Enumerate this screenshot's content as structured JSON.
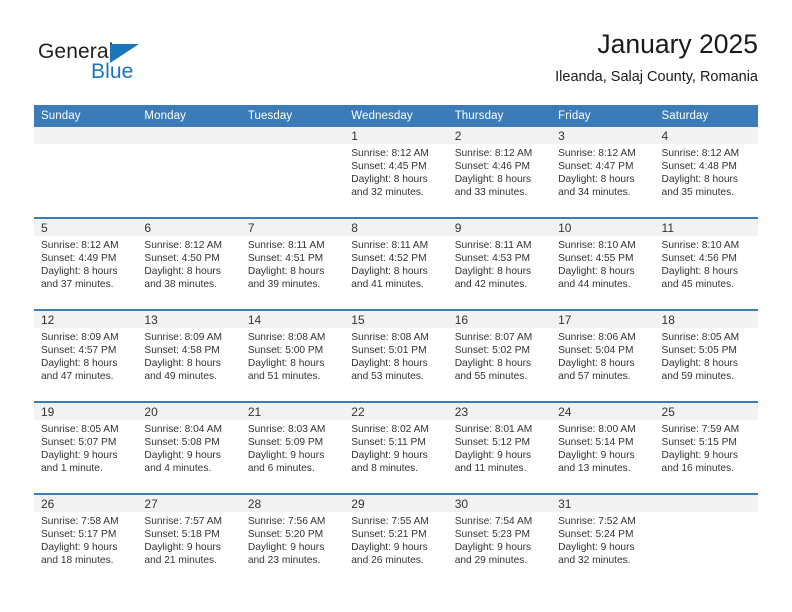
{
  "brand": {
    "word_one": "General",
    "word_two": "Blue",
    "triangle_color": "#1b75bb",
    "text_color": "#231f20"
  },
  "header": {
    "title": "January 2025",
    "subtitle": "Ileanda, Salaj County, Romania"
  },
  "theme": {
    "header_bg": "#3b7cb8",
    "header_text": "#ffffff",
    "daynum_band_bg": "#f2f2f2",
    "body_text": "#333333",
    "row_divider": "#3b7cb8"
  },
  "calendar": {
    "type": "table",
    "columns": [
      "Sunday",
      "Monday",
      "Tuesday",
      "Wednesday",
      "Thursday",
      "Friday",
      "Saturday"
    ],
    "weeks": [
      [
        {
          "day": "",
          "lines": []
        },
        {
          "day": "",
          "lines": []
        },
        {
          "day": "",
          "lines": []
        },
        {
          "day": "1",
          "lines": [
            "Sunrise: 8:12 AM",
            "Sunset: 4:45 PM",
            "Daylight: 8 hours",
            "and 32 minutes."
          ]
        },
        {
          "day": "2",
          "lines": [
            "Sunrise: 8:12 AM",
            "Sunset: 4:46 PM",
            "Daylight: 8 hours",
            "and 33 minutes."
          ]
        },
        {
          "day": "3",
          "lines": [
            "Sunrise: 8:12 AM",
            "Sunset: 4:47 PM",
            "Daylight: 8 hours",
            "and 34 minutes."
          ]
        },
        {
          "day": "4",
          "lines": [
            "Sunrise: 8:12 AM",
            "Sunset: 4:48 PM",
            "Daylight: 8 hours",
            "and 35 minutes."
          ]
        }
      ],
      [
        {
          "day": "5",
          "lines": [
            "Sunrise: 8:12 AM",
            "Sunset: 4:49 PM",
            "Daylight: 8 hours",
            "and 37 minutes."
          ]
        },
        {
          "day": "6",
          "lines": [
            "Sunrise: 8:12 AM",
            "Sunset: 4:50 PM",
            "Daylight: 8 hours",
            "and 38 minutes."
          ]
        },
        {
          "day": "7",
          "lines": [
            "Sunrise: 8:11 AM",
            "Sunset: 4:51 PM",
            "Daylight: 8 hours",
            "and 39 minutes."
          ]
        },
        {
          "day": "8",
          "lines": [
            "Sunrise: 8:11 AM",
            "Sunset: 4:52 PM",
            "Daylight: 8 hours",
            "and 41 minutes."
          ]
        },
        {
          "day": "9",
          "lines": [
            "Sunrise: 8:11 AM",
            "Sunset: 4:53 PM",
            "Daylight: 8 hours",
            "and 42 minutes."
          ]
        },
        {
          "day": "10",
          "lines": [
            "Sunrise: 8:10 AM",
            "Sunset: 4:55 PM",
            "Daylight: 8 hours",
            "and 44 minutes."
          ]
        },
        {
          "day": "11",
          "lines": [
            "Sunrise: 8:10 AM",
            "Sunset: 4:56 PM",
            "Daylight: 8 hours",
            "and 45 minutes."
          ]
        }
      ],
      [
        {
          "day": "12",
          "lines": [
            "Sunrise: 8:09 AM",
            "Sunset: 4:57 PM",
            "Daylight: 8 hours",
            "and 47 minutes."
          ]
        },
        {
          "day": "13",
          "lines": [
            "Sunrise: 8:09 AM",
            "Sunset: 4:58 PM",
            "Daylight: 8 hours",
            "and 49 minutes."
          ]
        },
        {
          "day": "14",
          "lines": [
            "Sunrise: 8:08 AM",
            "Sunset: 5:00 PM",
            "Daylight: 8 hours",
            "and 51 minutes."
          ]
        },
        {
          "day": "15",
          "lines": [
            "Sunrise: 8:08 AM",
            "Sunset: 5:01 PM",
            "Daylight: 8 hours",
            "and 53 minutes."
          ]
        },
        {
          "day": "16",
          "lines": [
            "Sunrise: 8:07 AM",
            "Sunset: 5:02 PM",
            "Daylight: 8 hours",
            "and 55 minutes."
          ]
        },
        {
          "day": "17",
          "lines": [
            "Sunrise: 8:06 AM",
            "Sunset: 5:04 PM",
            "Daylight: 8 hours",
            "and 57 minutes."
          ]
        },
        {
          "day": "18",
          "lines": [
            "Sunrise: 8:05 AM",
            "Sunset: 5:05 PM",
            "Daylight: 8 hours",
            "and 59 minutes."
          ]
        }
      ],
      [
        {
          "day": "19",
          "lines": [
            "Sunrise: 8:05 AM",
            "Sunset: 5:07 PM",
            "Daylight: 9 hours",
            "and 1 minute."
          ]
        },
        {
          "day": "20",
          "lines": [
            "Sunrise: 8:04 AM",
            "Sunset: 5:08 PM",
            "Daylight: 9 hours",
            "and 4 minutes."
          ]
        },
        {
          "day": "21",
          "lines": [
            "Sunrise: 8:03 AM",
            "Sunset: 5:09 PM",
            "Daylight: 9 hours",
            "and 6 minutes."
          ]
        },
        {
          "day": "22",
          "lines": [
            "Sunrise: 8:02 AM",
            "Sunset: 5:11 PM",
            "Daylight: 9 hours",
            "and 8 minutes."
          ]
        },
        {
          "day": "23",
          "lines": [
            "Sunrise: 8:01 AM",
            "Sunset: 5:12 PM",
            "Daylight: 9 hours",
            "and 11 minutes."
          ]
        },
        {
          "day": "24",
          "lines": [
            "Sunrise: 8:00 AM",
            "Sunset: 5:14 PM",
            "Daylight: 9 hours",
            "and 13 minutes."
          ]
        },
        {
          "day": "25",
          "lines": [
            "Sunrise: 7:59 AM",
            "Sunset: 5:15 PM",
            "Daylight: 9 hours",
            "and 16 minutes."
          ]
        }
      ],
      [
        {
          "day": "26",
          "lines": [
            "Sunrise: 7:58 AM",
            "Sunset: 5:17 PM",
            "Daylight: 9 hours",
            "and 18 minutes."
          ]
        },
        {
          "day": "27",
          "lines": [
            "Sunrise: 7:57 AM",
            "Sunset: 5:18 PM",
            "Daylight: 9 hours",
            "and 21 minutes."
          ]
        },
        {
          "day": "28",
          "lines": [
            "Sunrise: 7:56 AM",
            "Sunset: 5:20 PM",
            "Daylight: 9 hours",
            "and 23 minutes."
          ]
        },
        {
          "day": "29",
          "lines": [
            "Sunrise: 7:55 AM",
            "Sunset: 5:21 PM",
            "Daylight: 9 hours",
            "and 26 minutes."
          ]
        },
        {
          "day": "30",
          "lines": [
            "Sunrise: 7:54 AM",
            "Sunset: 5:23 PM",
            "Daylight: 9 hours",
            "and 29 minutes."
          ]
        },
        {
          "day": "31",
          "lines": [
            "Sunrise: 7:52 AM",
            "Sunset: 5:24 PM",
            "Daylight: 9 hours",
            "and 32 minutes."
          ]
        },
        {
          "day": "",
          "lines": []
        }
      ]
    ]
  }
}
